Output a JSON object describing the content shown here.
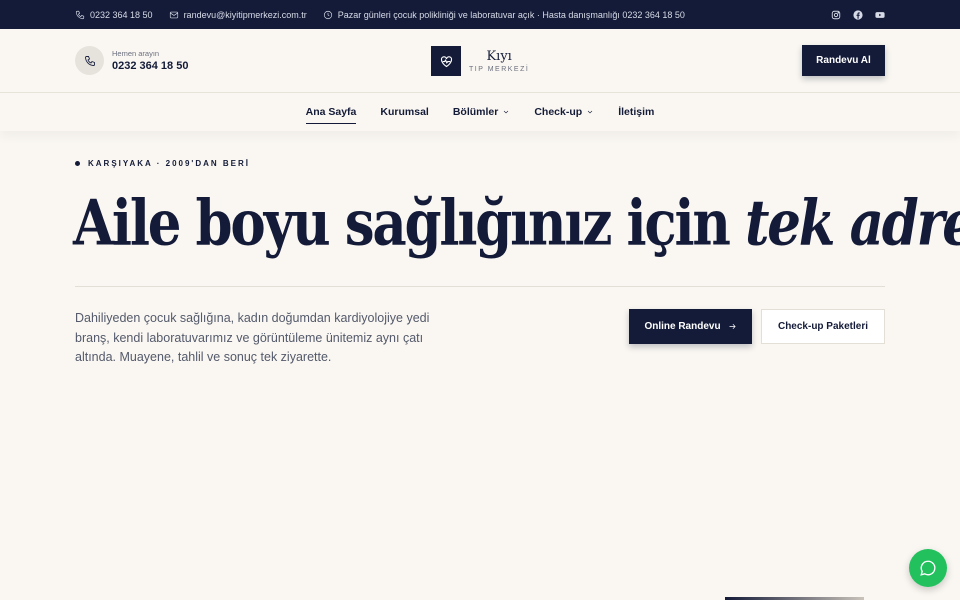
{
  "topbar": {
    "phone": "0232 364 18 50",
    "email": "randevu@kiyitipmerkezi.com.tr",
    "notice": "Pazar günleri çocuk polikliniği ve laboratuvar açık · Hasta danışmanlığı 0232 364 18 50",
    "social": [
      "instagram-icon",
      "facebook-icon",
      "youtube-icon"
    ]
  },
  "header": {
    "call_label": "Hemen arayın",
    "call_number": "0232 364 18 50",
    "logo_name": "Kıyı",
    "logo_sub": "TIP MERKEZİ",
    "cta_label": "Randevu Al"
  },
  "nav": {
    "items": [
      {
        "label": "Ana Sayfa",
        "active": true
      },
      {
        "label": "Kurumsal"
      },
      {
        "label": "Bölümler",
        "dropdown": true
      },
      {
        "label": "Check-up",
        "dropdown": true
      },
      {
        "label": "İletişim"
      }
    ]
  },
  "hero": {
    "eyebrow": "KARŞIYAKA · 2009'DAN BERİ",
    "headline_plain": "Aile boyu sağlığınız için ",
    "headline_italic": "tek adres",
    "lead": "Dahiliyeden çocuk sağlığına, kadın doğumdan kardiyolojiye yedi branş, kendi laboratuvarımız ve görüntüleme ünitemiz aynı çatı altında. Muayene, tahlil ve sonuç tek ziyarette.",
    "primary_button": "Online Randevu",
    "secondary_button": "Check-up Paketleri"
  },
  "colors": {
    "navy": "#141b38",
    "background": "#faf7f2",
    "whatsapp": "#22c15e"
  }
}
